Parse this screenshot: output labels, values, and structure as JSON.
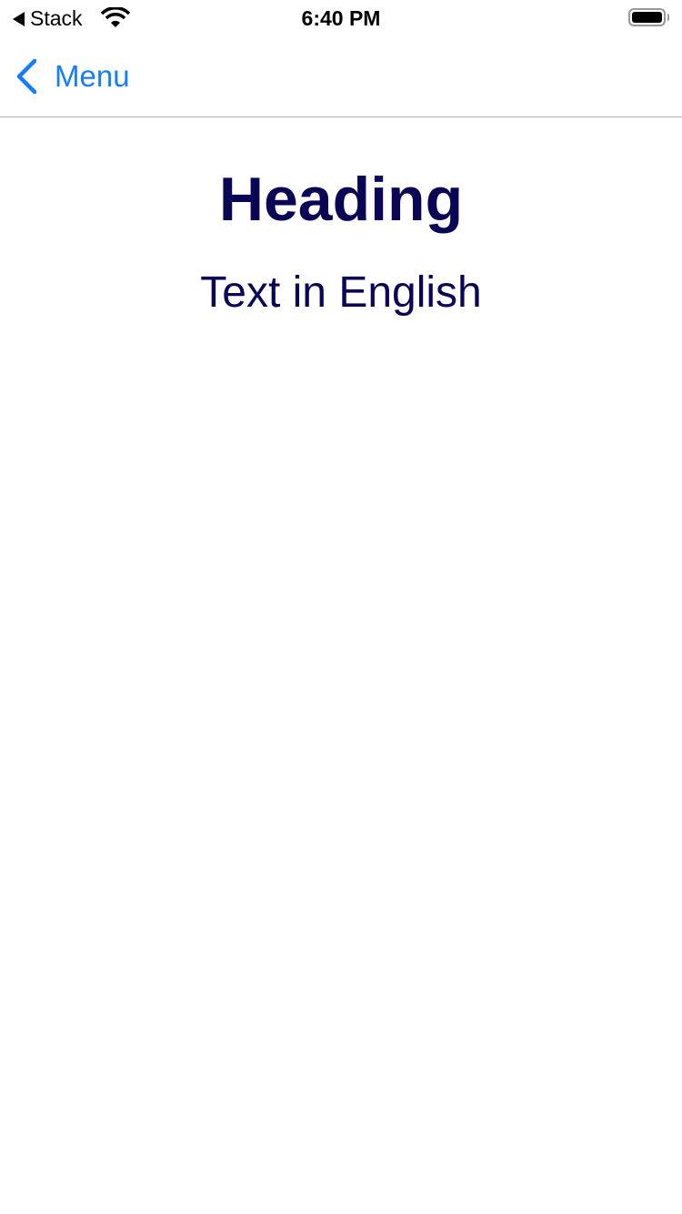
{
  "status_bar": {
    "back_app": "Stack",
    "time": "6:40 PM",
    "battery_level": 1.0
  },
  "nav": {
    "back_label": "Menu"
  },
  "content": {
    "heading": "Heading",
    "text": "Text in English"
  },
  "colors": {
    "accent": "#147efb",
    "text": "#0a0655"
  }
}
